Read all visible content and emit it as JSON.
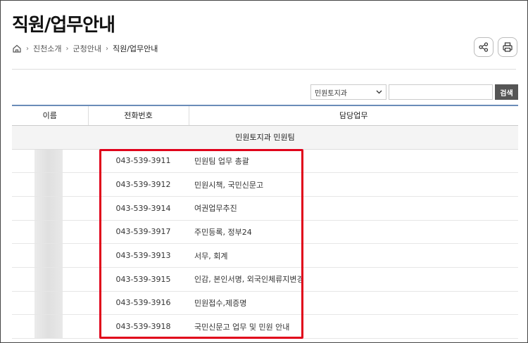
{
  "page": {
    "title": "직원/업무안내",
    "breadcrumb": [
      "진천소개",
      "군청안내",
      "직원/업무안내"
    ]
  },
  "search": {
    "select_value": "민원토지과",
    "button_label": "검색"
  },
  "table": {
    "headers": [
      "이름",
      "전화번호",
      "담당업무"
    ],
    "group": "민원토지과 민원팀",
    "rows": [
      {
        "phone": "043-539-3911",
        "duty": "민원팀 업무 총괄"
      },
      {
        "phone": "043-539-3912",
        "duty": "민원시책, 국민신문고"
      },
      {
        "phone": "043-539-3914",
        "duty": "여권업무추진"
      },
      {
        "phone": "043-539-3917",
        "duty": "주민등록, 정부24"
      },
      {
        "phone": "043-539-3913",
        "duty": "서무, 회계"
      },
      {
        "phone": "043-539-3915",
        "duty": "인감, 본인서명, 외국인체류지변경"
      },
      {
        "phone": "043-539-3916",
        "duty": "민원접수,제증명"
      },
      {
        "phone": "043-539-3918",
        "duty": "국민신문고 업무 및 민원 안내"
      }
    ]
  },
  "colors": {
    "highlight": "#e0001a",
    "header_line": "#6a8cb8"
  }
}
